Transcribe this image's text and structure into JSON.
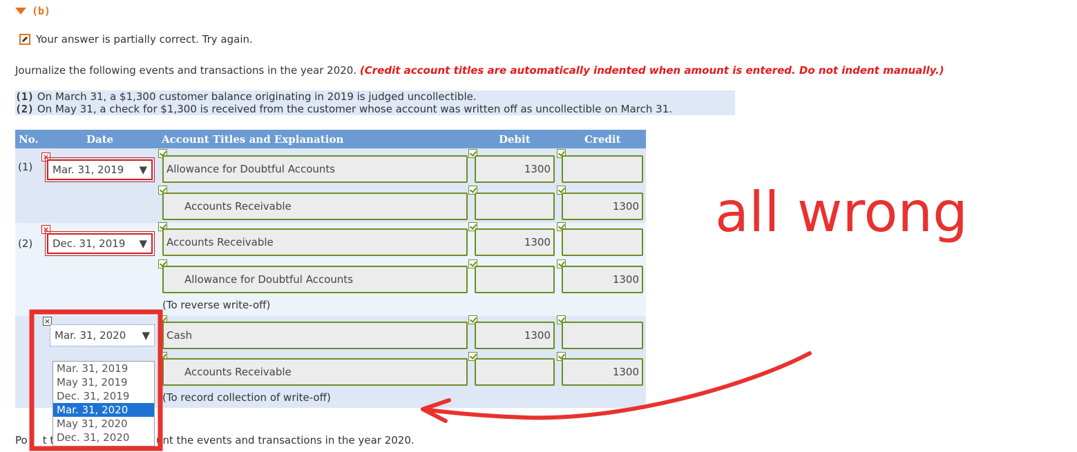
{
  "section": {
    "label": "(b)"
  },
  "status": {
    "message": "Your answer is partially correct.  Try again."
  },
  "instructions": {
    "text": "Journalize the following events and transactions in the year 2020.",
    "note": "(Credit account titles are automatically indented when amount is entered. Do not indent manually.)"
  },
  "events": [
    {
      "no": "(1)",
      "text": "On March 31, a $1,300 customer balance originating in 2019 is judged uncollectible."
    },
    {
      "no": "(2)",
      "text": "On May 31, a check for $1,300 is received from the customer whose account was written off as uncollectible on March 31."
    }
  ],
  "table": {
    "headers": {
      "no": "No.",
      "date": "Date",
      "account": "Account Titles and Explanation",
      "debit": "Debit",
      "credit": "Credit"
    },
    "entries": [
      {
        "no": "(1)",
        "date": "Mar. 31, 2019",
        "line1": {
          "account": "Allowance for Doubtful Accounts",
          "debit": "1300",
          "credit": ""
        },
        "line2": {
          "account": "Accounts Receivable",
          "debit": "",
          "credit": "1300"
        }
      },
      {
        "no": "(2)",
        "date": "Dec. 31, 2019",
        "line1": {
          "account": "Accounts Receivable",
          "debit": "1300",
          "credit": ""
        },
        "line2": {
          "account": "Allowance for Doubtful Accounts",
          "debit": "",
          "credit": "1300"
        },
        "note": "(To reverse write-off)"
      },
      {
        "no": "",
        "date": "Mar. 31, 2020",
        "line1": {
          "account": "Cash",
          "debit": "1300",
          "credit": ""
        },
        "line2": {
          "account": "Accounts Receivable",
          "debit": "",
          "credit": "1300"
        },
        "note": "(To record collection of write-off)"
      }
    ],
    "dropdown_options": [
      "Mar. 31, 2019",
      "May 31, 2019",
      "Dec. 31, 2019",
      "Mar. 31, 2020",
      "May 31, 2020",
      "Dec. 31, 2020"
    ],
    "dropdown_selected": "Mar. 31, 2020"
  },
  "bottom": {
    "left": "Po",
    "left2": "t to",
    "right": "unt the events and transactions in the year 2020."
  },
  "annotation": {
    "text": "all wrong",
    "color": "#e8322f"
  }
}
